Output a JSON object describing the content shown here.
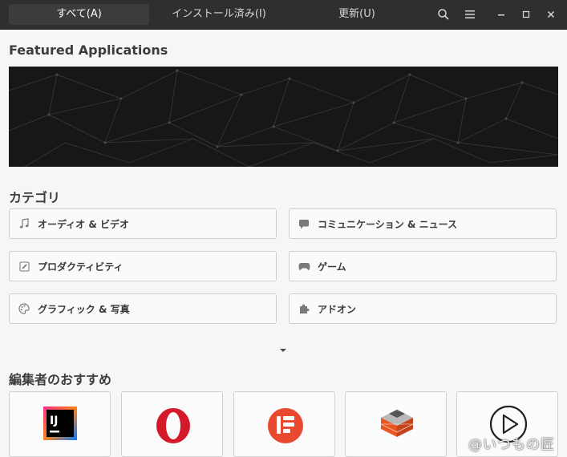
{
  "header": {
    "tabs": [
      {
        "label": "すべて(A)",
        "active": true
      },
      {
        "label": "インストール済み(I)",
        "active": false
      },
      {
        "label": "更新(U)",
        "active": false
      }
    ],
    "icons": [
      "search-icon",
      "menu-icon",
      "minimize-icon",
      "maximize-icon",
      "close-icon"
    ]
  },
  "featured": {
    "title": "Featured Applications"
  },
  "categories": {
    "title": "カテゴリ",
    "items": [
      {
        "label": "オーディオ & ビデオ",
        "icon": "music-note-icon"
      },
      {
        "label": "コミュニケーション & ニュース",
        "icon": "chat-bubble-icon"
      },
      {
        "label": "プロダクティビティ",
        "icon": "pencil-icon"
      },
      {
        "label": "ゲーム",
        "icon": "gamepad-icon"
      },
      {
        "label": "グラフィック & 写真",
        "icon": "palette-icon"
      },
      {
        "label": "アドオン",
        "icon": "puzzle-icon"
      }
    ],
    "expand_icon": "chevron-down-icon"
  },
  "editors_picks": {
    "title": "編集者のおすすめ",
    "apps": [
      {
        "name": "intellij-idea",
        "icon_text": "IJ"
      },
      {
        "name": "opera",
        "icon_text": ""
      },
      {
        "name": "app-red-circle",
        "icon_text": ""
      },
      {
        "name": "multipass",
        "icon_text": ""
      },
      {
        "name": "media-player",
        "icon_text": ""
      }
    ]
  },
  "watermark": {
    "text": "@いつもの匠"
  },
  "colors": {
    "titlebar": "#2f2f2f",
    "background": "#f6f6f6",
    "opera_red": "#d41a2a"
  }
}
